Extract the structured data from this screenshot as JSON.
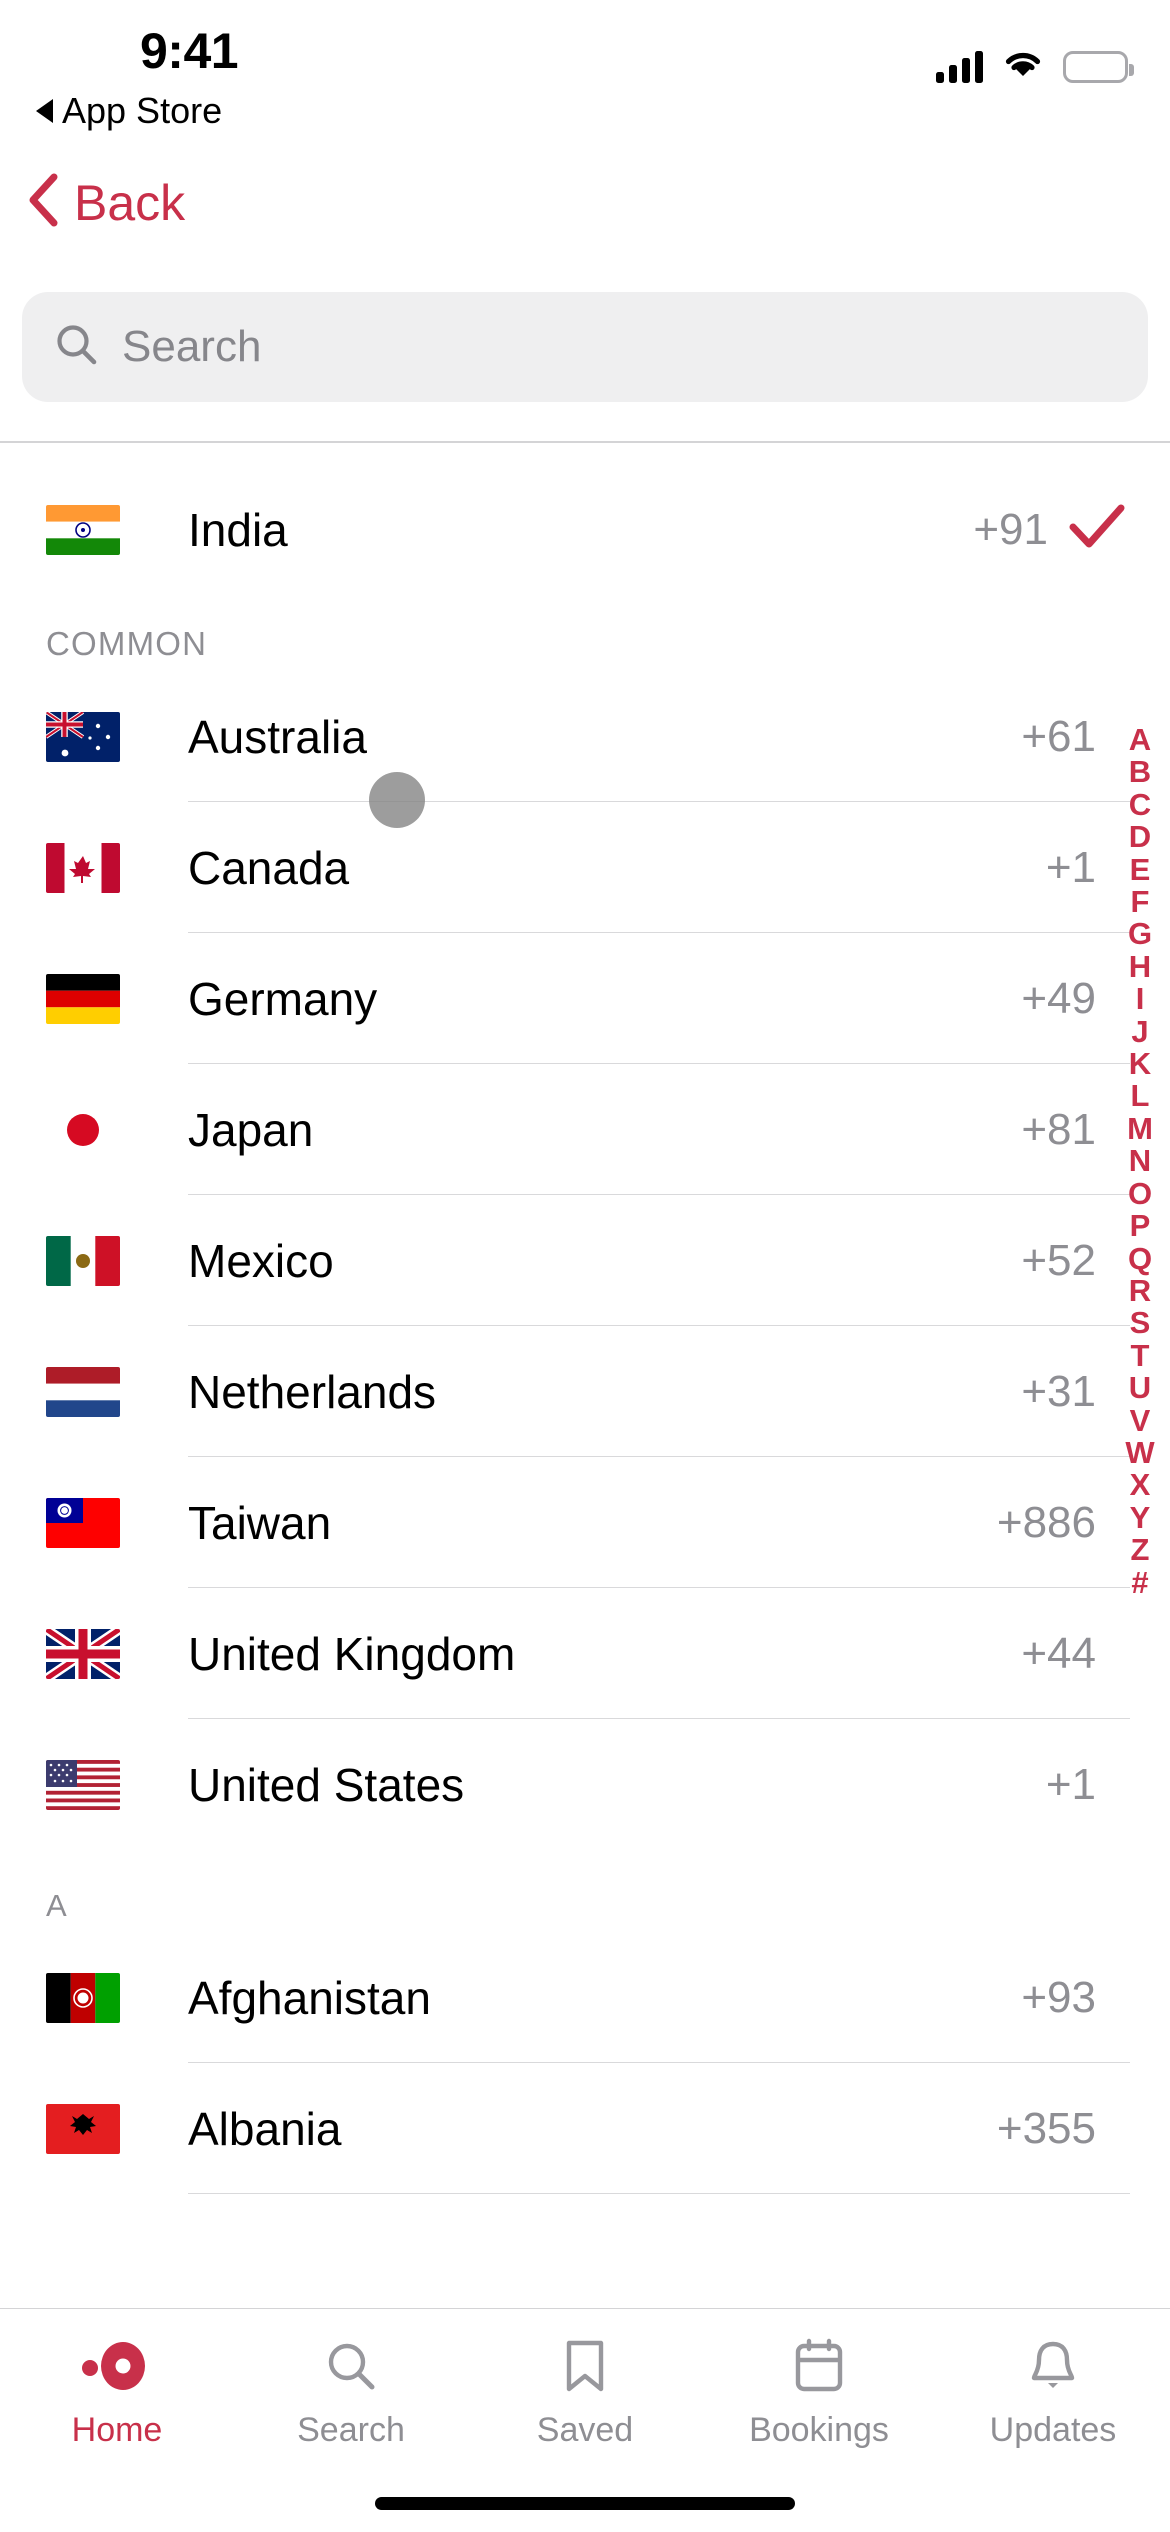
{
  "status_bar": {
    "time": "9:41",
    "back_app": "App Store",
    "signal_bars": 4,
    "wifi": true,
    "battery_full": true
  },
  "nav": {
    "back_label": "Back"
  },
  "search": {
    "placeholder": "Search",
    "value": ""
  },
  "colors": {
    "accent": "#C8304A",
    "secondary_text": "#8E8E93",
    "field_bg": "#EFEFF0"
  },
  "selected": {
    "name": "India",
    "dial_code": "+91",
    "checkmark": true
  },
  "sections": [
    {
      "title": "COMMON",
      "countries": [
        {
          "name": "Australia",
          "dial_code": "+61"
        },
        {
          "name": "Canada",
          "dial_code": "+1"
        },
        {
          "name": "Germany",
          "dial_code": "+49"
        },
        {
          "name": "Japan",
          "dial_code": "+81"
        },
        {
          "name": "Mexico",
          "dial_code": "+52"
        },
        {
          "name": "Netherlands",
          "dial_code": "+31"
        },
        {
          "name": "Taiwan",
          "dial_code": "+886"
        },
        {
          "name": "United Kingdom",
          "dial_code": "+44"
        },
        {
          "name": "United States",
          "dial_code": "+1"
        }
      ]
    },
    {
      "title": "A",
      "countries": [
        {
          "name": "Afghanistan",
          "dial_code": "+93"
        },
        {
          "name": "Albania",
          "dial_code": "+355"
        }
      ]
    }
  ],
  "index_letters": [
    "A",
    "B",
    "C",
    "D",
    "E",
    "F",
    "G",
    "H",
    "I",
    "J",
    "K",
    "L",
    "M",
    "N",
    "O",
    "P",
    "Q",
    "R",
    "S",
    "T",
    "U",
    "V",
    "W",
    "X",
    "Y",
    "Z",
    "#"
  ],
  "tabs": [
    {
      "label": "Home",
      "icon": "home-logo-icon",
      "active": true
    },
    {
      "label": "Search",
      "icon": "search-icon",
      "active": false
    },
    {
      "label": "Saved",
      "icon": "bookmark-icon",
      "active": false
    },
    {
      "label": "Bookings",
      "icon": "calendar-icon",
      "active": false
    },
    {
      "label": "Updates",
      "icon": "bell-icon",
      "active": false
    }
  ]
}
